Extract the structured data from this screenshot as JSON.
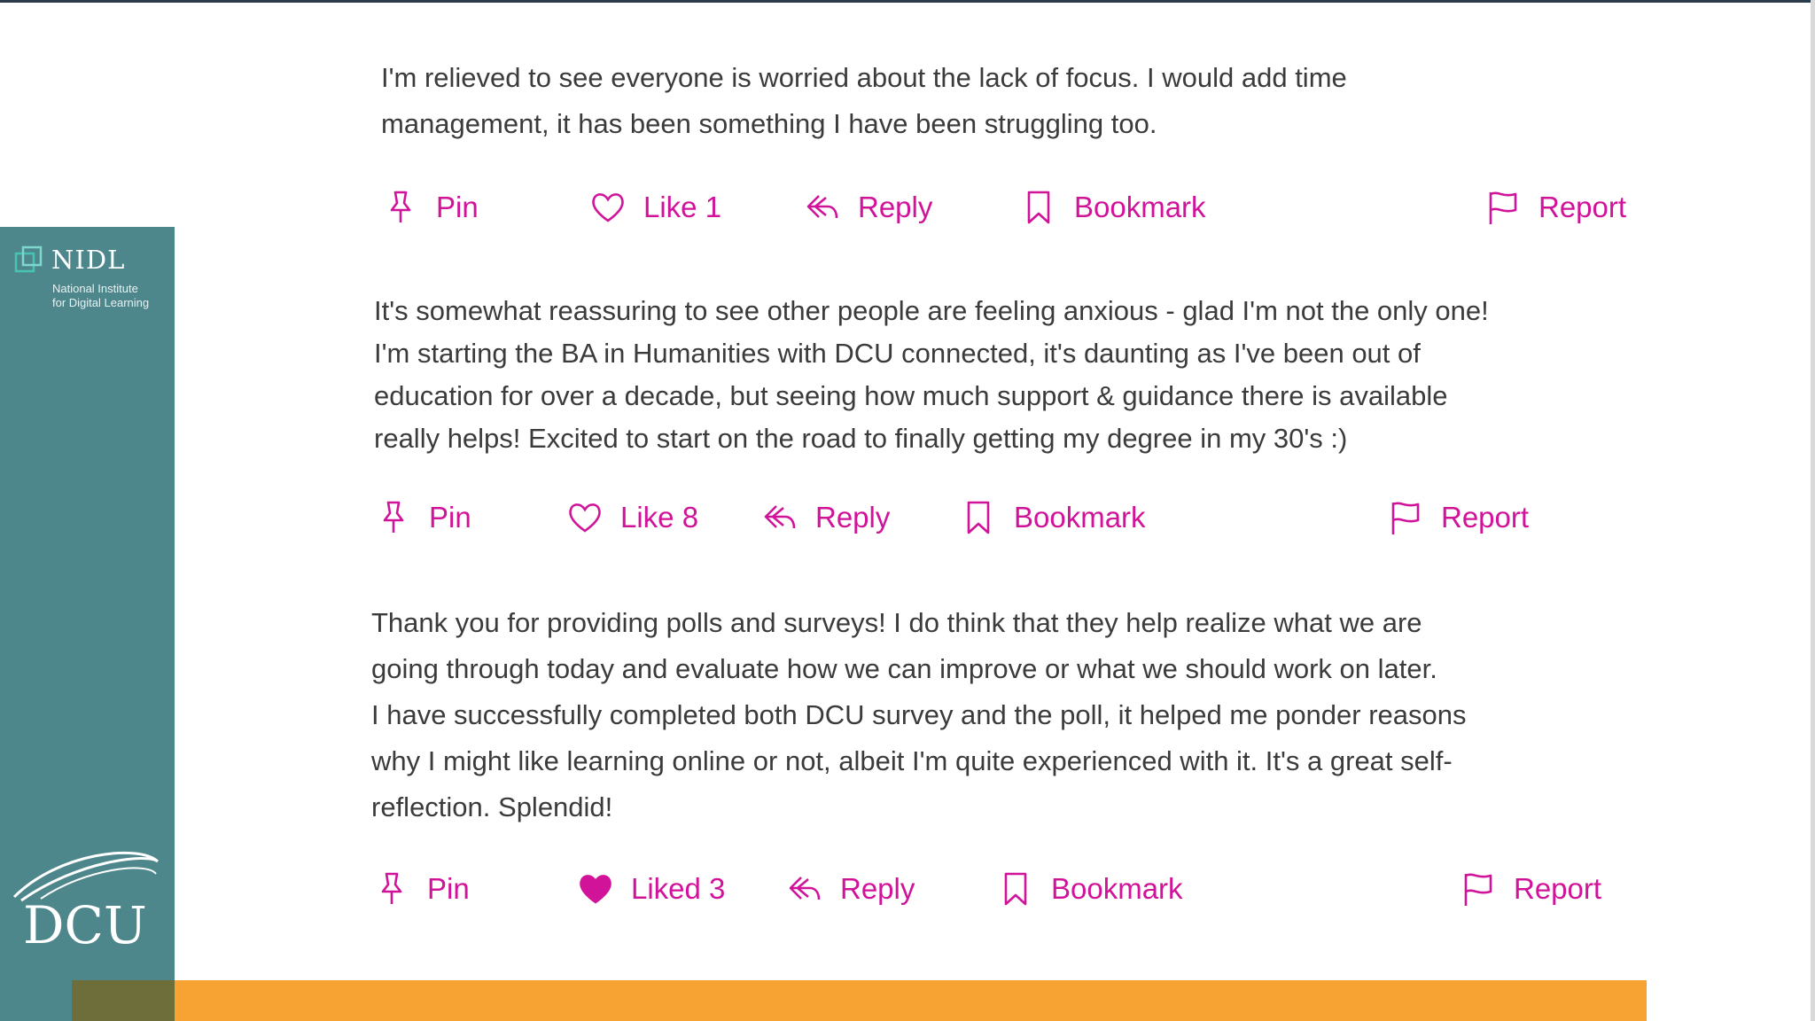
{
  "branding": {
    "nidl_title": "NIDL",
    "nidl_subtitle_line1": "National Institute",
    "nidl_subtitle_line2": "for Digital Learning",
    "dcu_wordmark": "DCU"
  },
  "colors": {
    "accent": "#d1139a",
    "sidebar": "#4d878c",
    "footer_bar": "#f7a333",
    "text": "#3b3b3b"
  },
  "posts": [
    {
      "lines": [
        "I'm relieved to see everyone is worried about the lack of focus. I would add time",
        "management, it has been something I have been struggling too."
      ],
      "actions": {
        "pin": "Pin",
        "like": "Like 1",
        "reply": "Reply",
        "bookmark": "Bookmark",
        "report": "Report"
      },
      "liked": false
    },
    {
      "lines": [
        "It's somewhat reassuring to see other people are feeling anxious - glad I'm not the only one!",
        "I'm starting the BA in Humanities with DCU connected, it's daunting as I've been out of",
        "education for over a decade, but seeing how much support & guidance there is available",
        "really helps! Excited to start on the road to finally getting my degree in my 30's :)"
      ],
      "actions": {
        "pin": "Pin",
        "like": "Like 8",
        "reply": "Reply",
        "bookmark": "Bookmark",
        "report": "Report"
      },
      "liked": false
    },
    {
      "lines": [
        "Thank you for providing polls and surveys! I do think that they help realize what we are",
        "going through today and evaluate how we can improve or what we should work on later.",
        "I have successfully completed both DCU survey and the poll, it helped me ponder reasons",
        "why I might like learning online or not, albeit I'm quite experienced with it. It's a great self-",
        "reflection. Splendid!"
      ],
      "actions": {
        "pin": "Pin",
        "like": "Liked 3",
        "reply": "Reply",
        "bookmark": "Bookmark",
        "report": "Report"
      },
      "liked": true
    }
  ]
}
